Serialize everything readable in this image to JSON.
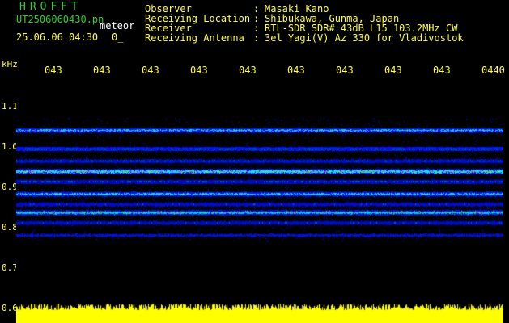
{
  "header": {
    "app_title": "HROFFT",
    "filename": "UT2506060430.pn",
    "meteor_label": "meteor",
    "datetime": "25.06.06 04:30",
    "count": "0_",
    "info": [
      {
        "label": "Observer",
        "value": "Masaki Kano"
      },
      {
        "label": "Receiving Location",
        "value": "Shibukawa, Gunma, Japan"
      },
      {
        "label": "Receiver",
        "value": "RTL-SDR SDR# 43dB L15 103.2MHz CW"
      },
      {
        "label": "Receiving Antenna",
        "value": "3el Yagi(V) Az 330 for Vladivostok"
      }
    ]
  },
  "axis": {
    "unit": "kHz",
    "y_ticks": [
      "1.1",
      "1.0",
      "0.9",
      "0.8",
      "0.7",
      "0.6"
    ],
    "x_ticks": [
      "043",
      "043",
      "043",
      "043",
      "043",
      "043",
      "043",
      "043",
      "043",
      "0440"
    ]
  },
  "spectrogram": {
    "freq_range_khz": [
      0.6,
      1.15
    ],
    "bands_khz": [
      1.03,
      0.985,
      0.955,
      0.93,
      0.905,
      0.875,
      0.85,
      0.83,
      0.805,
      0.775
    ],
    "band_intensity": [
      0.75,
      0.55,
      0.5,
      1.0,
      0.55,
      0.75,
      0.45,
      0.9,
      0.45,
      0.35
    ],
    "colors": {
      "background": "#000000",
      "low": "#0010ff",
      "mid": "#00e0ff",
      "high": "#40ff40",
      "peak": "#ff3060",
      "level": "#ffff00"
    }
  }
}
